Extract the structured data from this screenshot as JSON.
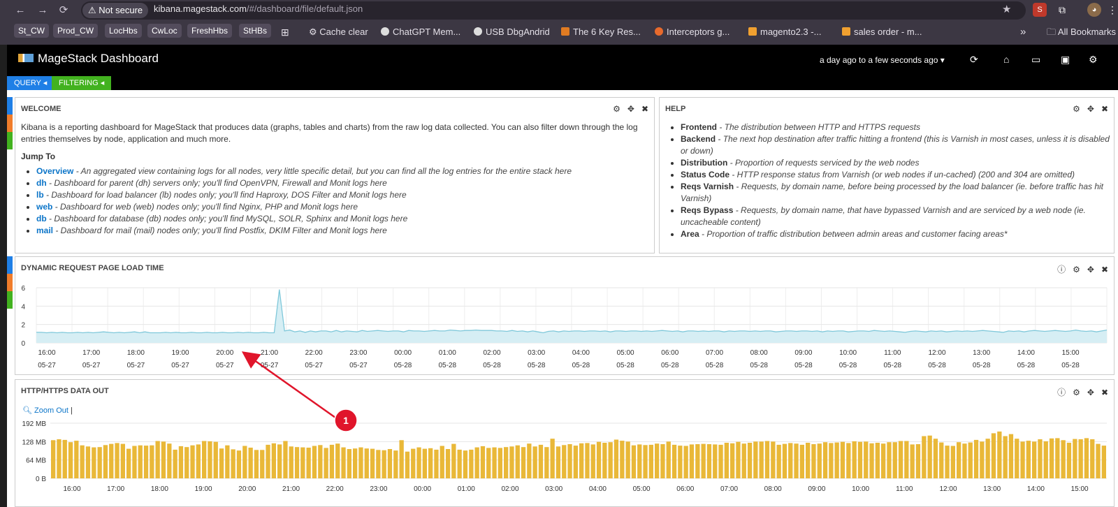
{
  "browser": {
    "not_secure": "Not secure",
    "url_host": "kibana.magestack.com",
    "url_path": "/#/dashboard/file/default.json",
    "bookmarks": [
      "St_CW",
      "Prod_CW",
      "LocHbs",
      "CwLoc",
      "FreshHbs",
      "StHBs"
    ],
    "bookmark_links": [
      "Cache clear",
      "ChatGPT Mem...",
      "USB DbgAndrid",
      "The 6 Key Res...",
      "Interceptors g...",
      "magento2.3 -...",
      "sales order - m..."
    ],
    "more": "»",
    "all_bookmarks": "All Bookmarks"
  },
  "app": {
    "title": "MageStack Dashboard",
    "timerange": "a day ago to a few seconds ago ▾",
    "pills": [
      "QUERY ◂",
      "FILTERING ◂"
    ],
    "colors": {
      "query": "#1f7fe6",
      "filtering": "#42b21f",
      "accent_orange": "#f07c2a"
    }
  },
  "welcome": {
    "title": "WELCOME",
    "intro": "Kibana is a reporting dashboard for MageStack that produces data (graphs, tables and charts) from the raw log data collected. You can also filter down through the log entries themselves by node, application and much more.",
    "jump_to": "Jump To",
    "links": [
      {
        "name": "Overview",
        "desc": " - An aggregated view containing logs for all nodes, very little specific detail, but you can find all the log entries for the entire stack here"
      },
      {
        "name": "dh",
        "desc": " - Dashboard for parent (dh) servers only; you'll find OpenVPN, Firewall and Monit logs here"
      },
      {
        "name": "lb",
        "desc": " - Dashboard for load balancer (lb) nodes only; you'll find Haproxy, DOS Filter and Monit logs here"
      },
      {
        "name": "web",
        "desc": " - Dashboard for web (web) nodes only; you'll find Nginx, PHP and Monit logs here"
      },
      {
        "name": "db",
        "desc": " - Dashboard for database (db) nodes only; you'll find MySQL, SOLR, Sphinx and Monit logs here"
      },
      {
        "name": "mail",
        "desc": " - Dashboard for mail (mail) nodes only; you'll find Postfix, DKIM Filter and Monit logs here"
      }
    ]
  },
  "help": {
    "title": "HELP",
    "items": [
      {
        "term": "Frontend",
        "desc": " - The distribution between HTTP and HTTPS requests"
      },
      {
        "term": "Backend",
        "desc": " - The next hop destination after traffic hitting a frontend (this is Varnish in most cases, unless it is disabled or down)"
      },
      {
        "term": "Distribution",
        "desc": " - Proportion of requests serviced by the web nodes"
      },
      {
        "term": "Status Code",
        "desc": " - HTTP response status from Varnish (or web nodes if un-cached) (200 and 304 are omitted)"
      },
      {
        "term": "Reqs Varnish",
        "desc": " - Requests, by domain name, before being processed by the load balancer (ie. before traffic has hit Varnish)"
      },
      {
        "term": "Reqs Bypass",
        "desc": " - Requests, by domain name, that have bypassed Varnish and are serviced by a web node (ie. uncacheable content)"
      },
      {
        "term": "Area",
        "desc": " - Proportion of traffic distribution between admin areas and customer facing areas*"
      }
    ]
  },
  "panel_load": {
    "title": "DYNAMIC REQUEST PAGE LOAD TIME"
  },
  "panel_data": {
    "title": "HTTP/HTTPS DATA OUT",
    "zoom_out": "Zoom Out"
  },
  "annotation": {
    "label": "1"
  },
  "chart_data": [
    {
      "type": "area",
      "y_ticks": [
        "0",
        "2",
        "4",
        "6"
      ],
      "ylim": [
        0,
        6
      ],
      "x_ticks": [
        [
          "16:00",
          "05-27"
        ],
        [
          "17:00",
          "05-27"
        ],
        [
          "18:00",
          "05-27"
        ],
        [
          "19:00",
          "05-27"
        ],
        [
          "20:00",
          "05-27"
        ],
        [
          "21:00",
          "05-27"
        ],
        [
          "22:00",
          "05-27"
        ],
        [
          "23:00",
          "05-27"
        ],
        [
          "00:00",
          "05-28"
        ],
        [
          "01:00",
          "05-28"
        ],
        [
          "02:00",
          "05-28"
        ],
        [
          "03:00",
          "05-28"
        ],
        [
          "04:00",
          "05-28"
        ],
        [
          "05:00",
          "05-28"
        ],
        [
          "06:00",
          "05-28"
        ],
        [
          "07:00",
          "05-28"
        ],
        [
          "08:00",
          "05-28"
        ],
        [
          "09:00",
          "05-28"
        ],
        [
          "10:00",
          "05-28"
        ],
        [
          "11:00",
          "05-28"
        ],
        [
          "12:00",
          "05-28"
        ],
        [
          "13:00",
          "05-28"
        ],
        [
          "14:00",
          "05-28"
        ],
        [
          "15:00",
          "05-28"
        ]
      ],
      "values": [
        1.15,
        1.15,
        1.1,
        1.15,
        1.1,
        1.15,
        1.1,
        1.1,
        1.15,
        1.1,
        1.15,
        1.1,
        1.15,
        1.2,
        1.15,
        1.1,
        1.15,
        1.1,
        1.15,
        1.2,
        1.1,
        1.2,
        1.1,
        1.1,
        1.1,
        1.15,
        1.1,
        1.15,
        1.1,
        1.1,
        1.15,
        1.1,
        1.1,
        1.15,
        1.1,
        1.1,
        1.15,
        1.1,
        1.1,
        1.15,
        1.1,
        1.15,
        1.1,
        1.1,
        1.15,
        1.1,
        1.1,
        5.8,
        1.3,
        1.4,
        1.2,
        1.3,
        1.15,
        1.3,
        1.2,
        1.3,
        1.3,
        1.2,
        1.35,
        1.2,
        1.3,
        1.25,
        1.2,
        1.35,
        1.25,
        1.3,
        1.35,
        1.3,
        1.25,
        1.3,
        1.3,
        1.2,
        1.35,
        1.3,
        1.3,
        1.25,
        1.3,
        1.35,
        1.3,
        1.3,
        1.4,
        1.35,
        1.3,
        1.35,
        1.35,
        1.4,
        1.35,
        1.35,
        1.35,
        1.3,
        1.3,
        1.25,
        1.35,
        1.25,
        1.3,
        1.2,
        1.3,
        1.2,
        1.1,
        1.25,
        1.3,
        1.2,
        1.3,
        1.25,
        1.3,
        1.3,
        1.25,
        1.3,
        1.3,
        1.25,
        1.3,
        1.2,
        1.3,
        1.3,
        1.25,
        1.3,
        1.3,
        1.25,
        1.3,
        1.25,
        1.3,
        1.35,
        1.3,
        1.25,
        1.3,
        1.2,
        1.3,
        1.3,
        1.25,
        1.3,
        1.25,
        1.3,
        1.3,
        1.2,
        1.3,
        1.25,
        1.3,
        1.3,
        1.25,
        1.3,
        1.25,
        1.3,
        1.3,
        1.2,
        1.25,
        1.3,
        1.3,
        1.25,
        1.3,
        1.3,
        1.25,
        1.3,
        1.2,
        1.3,
        1.25,
        1.3,
        1.3,
        1.2,
        1.25,
        1.3,
        1.3,
        1.25,
        1.35,
        1.3,
        1.25,
        1.3,
        1.25,
        1.2,
        1.15,
        1.25,
        1.3,
        1.25,
        1.2,
        1.3,
        1.25,
        1.3,
        1.2,
        1.25,
        1.3,
        1.25,
        1.3,
        1.25,
        1.3,
        1.35,
        1.3,
        1.25,
        1.2,
        1.15,
        1.3,
        1.25,
        1.3,
        1.2,
        1.3,
        1.35,
        1.3,
        1.25,
        1.3,
        1.35,
        1.3,
        1.25,
        1.3,
        1.4,
        1.3,
        1.25,
        1.3,
        1.2,
        1.3,
        1.4
      ]
    },
    {
      "type": "bar",
      "y_ticks": [
        "0 B",
        "64 MB",
        "128 MB",
        "192 MB"
      ],
      "ylim": [
        0,
        192
      ],
      "x_ticks": [
        "16:00",
        "17:00",
        "18:00",
        "19:00",
        "20:00",
        "21:00",
        "22:00",
        "23:00",
        "00:00",
        "01:00",
        "02:00",
        "03:00",
        "04:00",
        "05:00",
        "06:00",
        "07:00",
        "08:00",
        "09:00",
        "10:00",
        "11:00",
        "12:00",
        "13:00",
        "14:00",
        "15:00"
      ],
      "values": [
        133,
        136,
        134,
        126,
        131,
        115,
        111,
        108,
        109,
        116,
        120,
        123,
        120,
        103,
        113,
        115,
        114,
        115,
        130,
        128,
        121,
        100,
        112,
        109,
        115,
        118,
        130,
        129,
        127,
        104,
        115,
        101,
        97,
        113,
        107,
        99,
        99,
        117,
        122,
        118,
        130,
        111,
        109,
        108,
        107,
        113,
        116,
        106,
        117,
        121,
        108,
        102,
        104,
        108,
        104,
        103,
        99,
        98,
        102,
        97,
        133,
        93,
        103,
        108,
        103,
        105,
        100,
        113,
        102,
        120,
        100,
        97,
        100,
        108,
        112,
        106,
        108,
        106,
        109,
        111,
        115,
        109,
        121,
        111,
        117,
        109,
        138,
        111,
        116,
        119,
        114,
        122,
        123,
        118,
        127,
        124,
        126,
        135,
        131,
        128,
        115,
        118,
        116,
        117,
        121,
        119,
        128,
        117,
        114,
        113,
        118,
        119,
        120,
        119,
        118,
        117,
        124,
        122,
        127,
        121,
        124,
        128,
        128,
        130,
        128,
        117,
        120,
        123,
        121,
        117,
        124,
        119,
        121,
        126,
        123,
        125,
        127,
        123,
        129,
        127,
        128,
        122,
        124,
        121,
        126,
        126,
        130,
        130,
        118,
        119,
        147,
        149,
        138,
        125,
        114,
        113,
        126,
        121,
        125,
        134,
        128,
        138,
        157,
        163,
        147,
        154,
        138,
        128,
        131,
        128,
        136,
        129,
        139,
        140,
        133,
        124,
        137,
        136,
        140,
        136,
        120,
        114
      ]
    }
  ]
}
